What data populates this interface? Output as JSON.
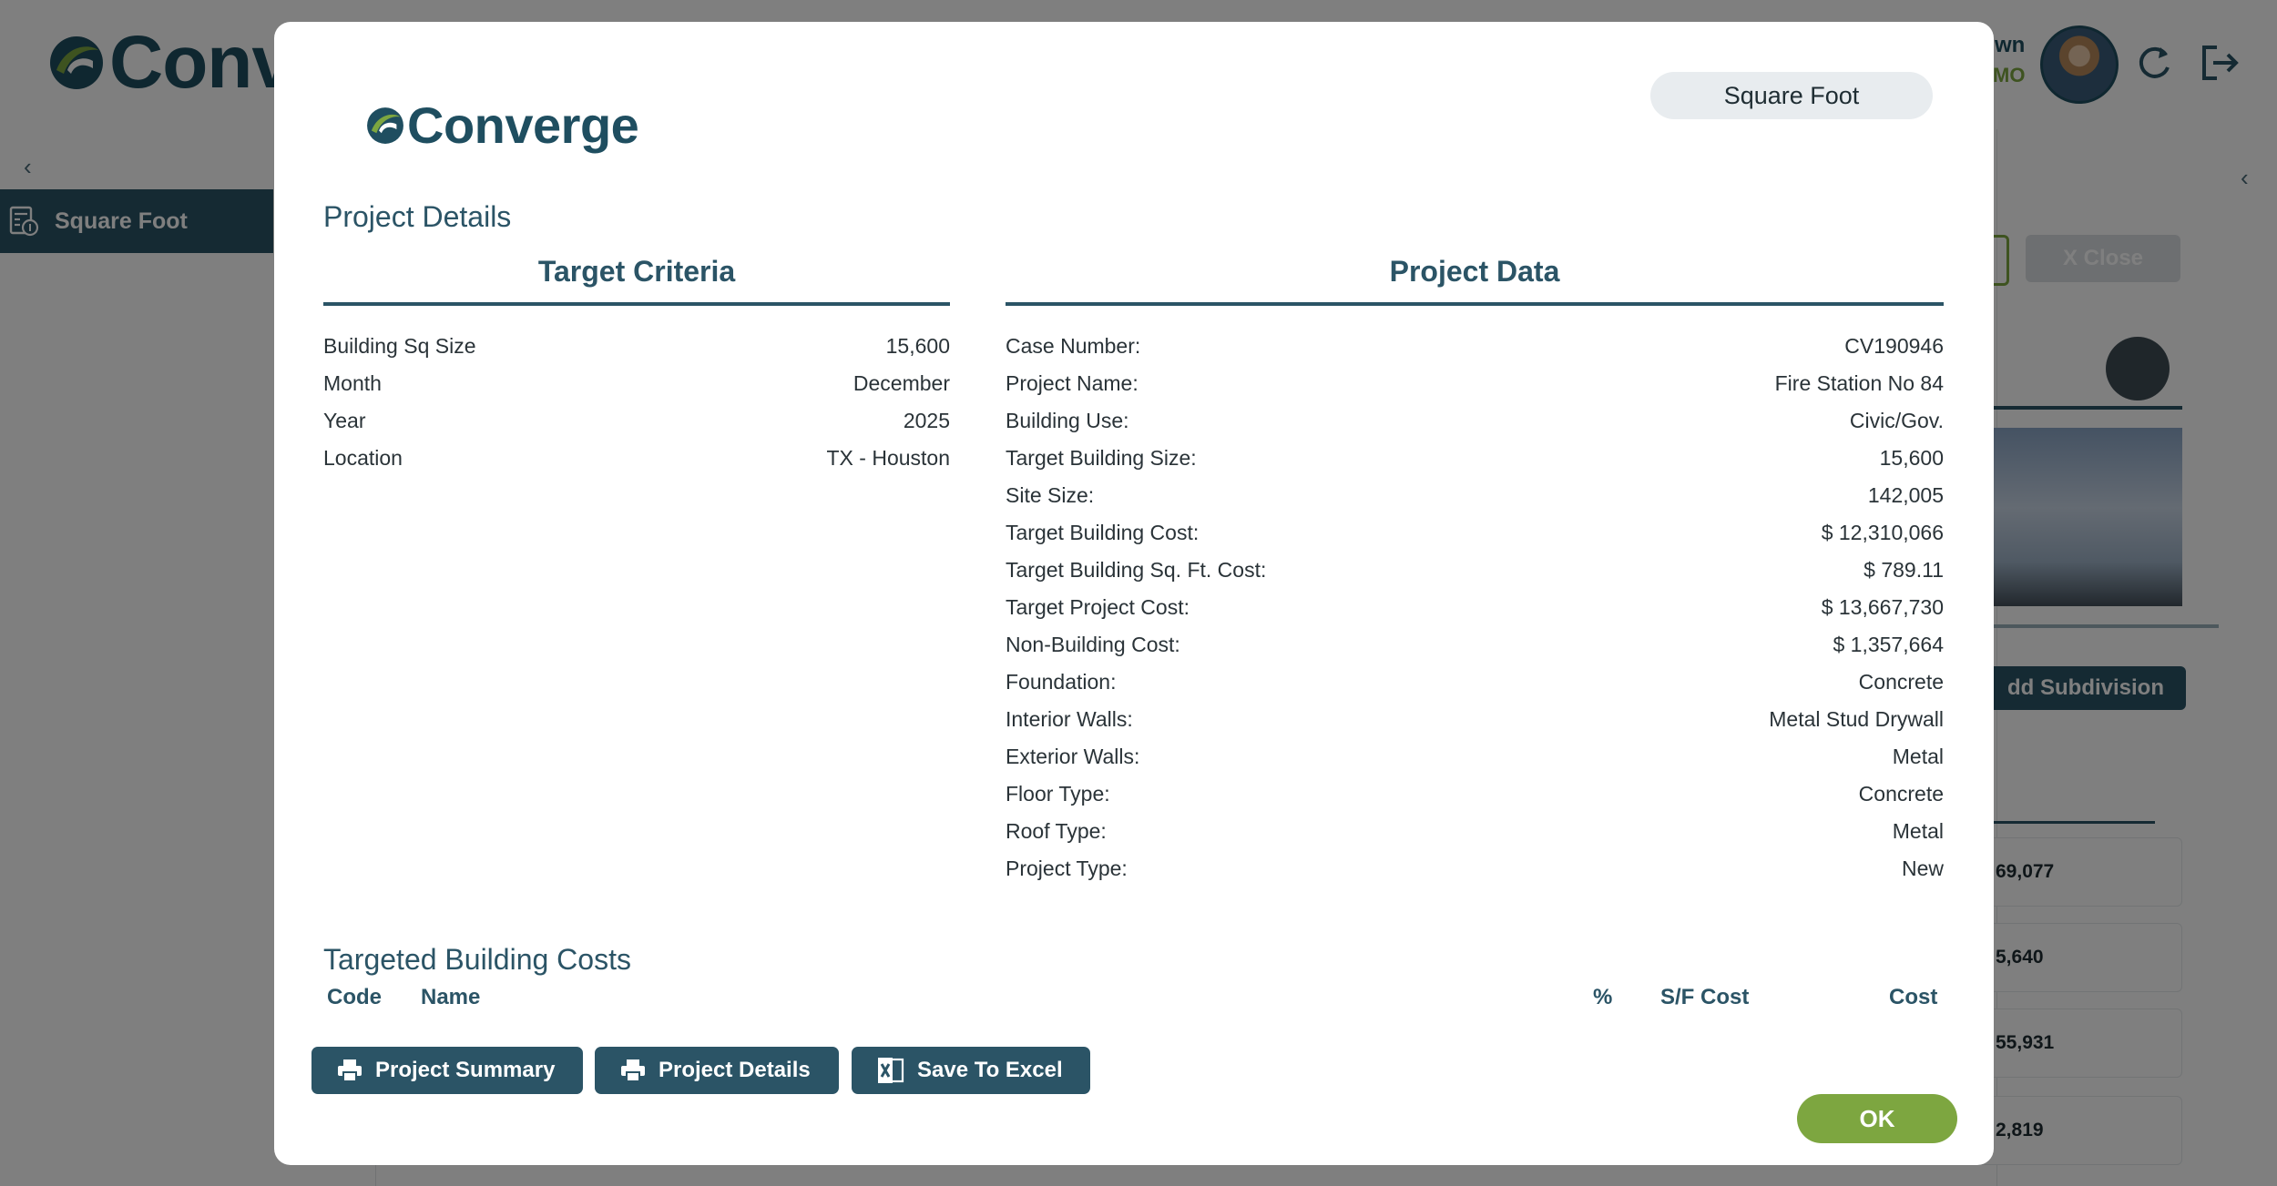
{
  "app": {
    "brand_partial": "Conv",
    "sidebar": {
      "active_item": "Square Foot"
    },
    "user": {
      "name_partial": "wn",
      "role_partial": "MO"
    },
    "right_panel": {
      "close_label": "X Close",
      "add_subdivision_label": "dd Subdivision",
      "cards": [
        "69,077",
        "5,640",
        "55,931",
        "2,819"
      ]
    }
  },
  "modal": {
    "brand": "Converge",
    "type_pill": "Square Foot",
    "section_title": "Project Details",
    "target_criteria": {
      "heading": "Target Criteria",
      "rows": [
        {
          "label": "Building Sq Size",
          "value": "15,600"
        },
        {
          "label": "Month",
          "value": "December"
        },
        {
          "label": "Year",
          "value": "2025"
        },
        {
          "label": "Location",
          "value": "TX - Houston"
        }
      ]
    },
    "project_data": {
      "heading": "Project Data",
      "rows": [
        {
          "label": "Case Number:",
          "value": "CV190946"
        },
        {
          "label": "Project Name:",
          "value": "Fire Station No 84"
        },
        {
          "label": "Building Use:",
          "value": "Civic/Gov."
        },
        {
          "label": "Target Building Size:",
          "value": "15,600"
        },
        {
          "label": "Site Size:",
          "value": "142,005"
        },
        {
          "label": "Target Building Cost:",
          "value": "$ 12,310,066"
        },
        {
          "label": "Target Building Sq. Ft. Cost:",
          "value": "$ 789.11"
        },
        {
          "label": "Target Project Cost:",
          "value": "$ 13,667,730"
        },
        {
          "label": "Non-Building Cost:",
          "value": "$ 1,357,664"
        },
        {
          "label": "Foundation:",
          "value": "Concrete"
        },
        {
          "label": "Interior Walls:",
          "value": "Metal Stud Drywall"
        },
        {
          "label": "Exterior Walls:",
          "value": "Metal"
        },
        {
          "label": "Floor Type:",
          "value": "Concrete"
        },
        {
          "label": "Roof Type:",
          "value": "Metal"
        },
        {
          "label": "Project Type:",
          "value": "New"
        }
      ]
    },
    "costs": {
      "title": "Targeted Building Costs",
      "columns": {
        "code": "Code",
        "name": "Name",
        "percent": "%",
        "sf_cost": "S/F Cost",
        "cost": "Cost"
      }
    },
    "buttons": {
      "project_summary": "Project Summary",
      "project_details": "Project Details",
      "save_to_excel": "Save To Excel",
      "ok": "OK"
    }
  },
  "colors": {
    "primary": "#2b5466",
    "accent_green": "#7da640",
    "brand_text": "#1f4e60",
    "overlay": "rgba(0,0,0,0.5)"
  },
  "icons": [
    "converge-logo-icon",
    "calculator-icon",
    "refresh-icon",
    "logout-icon",
    "camera-add-icon",
    "chevron-left-icon",
    "printer-icon",
    "excel-icon"
  ]
}
